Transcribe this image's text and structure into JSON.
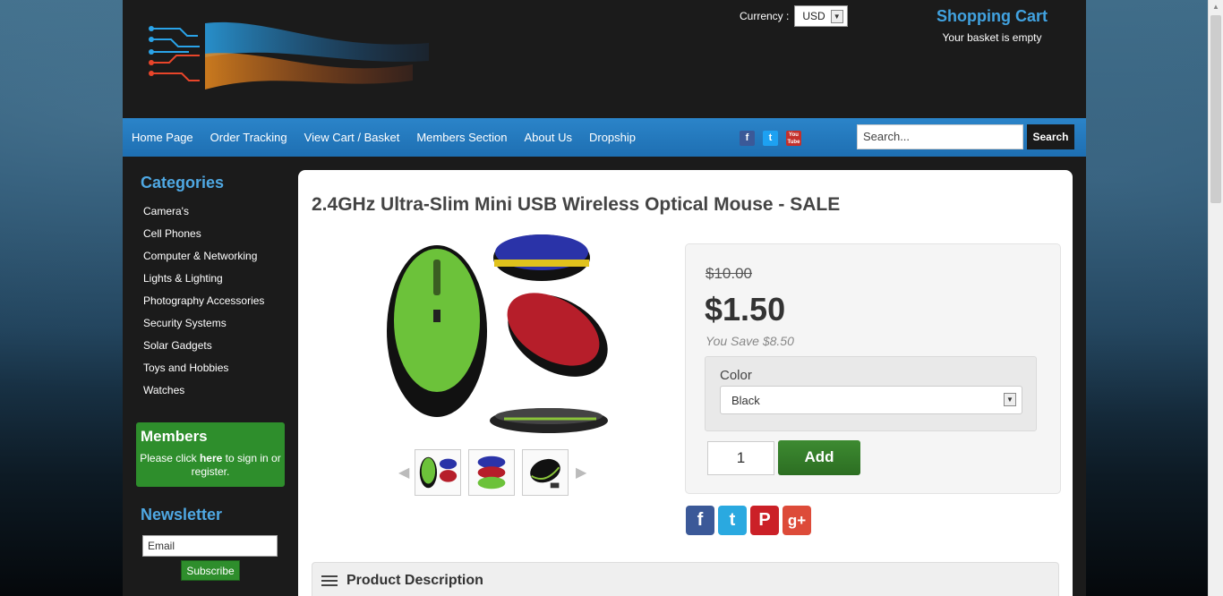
{
  "header": {
    "currency_label": "Currency :",
    "currency_value": "USD",
    "cart_title": "Shopping Cart",
    "cart_status": "Your basket is empty"
  },
  "nav": {
    "items": [
      "Home Page",
      "Order Tracking",
      "View Cart / Basket",
      "Members Section",
      "About Us",
      "Dropship"
    ],
    "social": [
      {
        "icon": "facebook-icon",
        "glyph": "f",
        "color": "#3b5998"
      },
      {
        "icon": "twitter-icon",
        "glyph": "t",
        "color": "#1da1f2"
      },
      {
        "icon": "youtube-icon",
        "glyph": "You Tube",
        "color": "#c4302b"
      }
    ],
    "search_placeholder": "Search...",
    "search_button": "Search"
  },
  "sidebar": {
    "categories_heading": "Categories",
    "categories": [
      "Camera's",
      "Cell Phones",
      "Computer & Networking",
      "Lights & Lighting",
      "Photography Accessories",
      "Security Systems",
      "Solar Gadgets",
      "Toys and Hobbies",
      "Watches"
    ],
    "members_heading": "Members",
    "members_text_pre": "Please click",
    "members_link": "here",
    "members_text_post": "to sign in or register.",
    "newsletter_heading": "Newsletter",
    "email_placeholder": "Email",
    "subscribe_label": "Subscribe"
  },
  "product": {
    "title": "2.4GHz Ultra-Slim Mini USB Wireless Optical Mouse - SALE",
    "old_price": "$10.00",
    "price": "$1.50",
    "you_save": "You Save $8.50",
    "color_label": "Color",
    "color_value": "Black",
    "quantity": "1",
    "add_label": "Add",
    "description_heading": "Product Description"
  },
  "share": [
    {
      "icon": "facebook-share-icon",
      "glyph": "f",
      "color": "#3b5998"
    },
    {
      "icon": "twitter-share-icon",
      "glyph": "t",
      "color": "#2aa9e0"
    },
    {
      "icon": "pinterest-share-icon",
      "glyph": "P",
      "color": "#cb2027"
    },
    {
      "icon": "google-plus-share-icon",
      "glyph": "g+",
      "color": "#dd4b39"
    }
  ]
}
